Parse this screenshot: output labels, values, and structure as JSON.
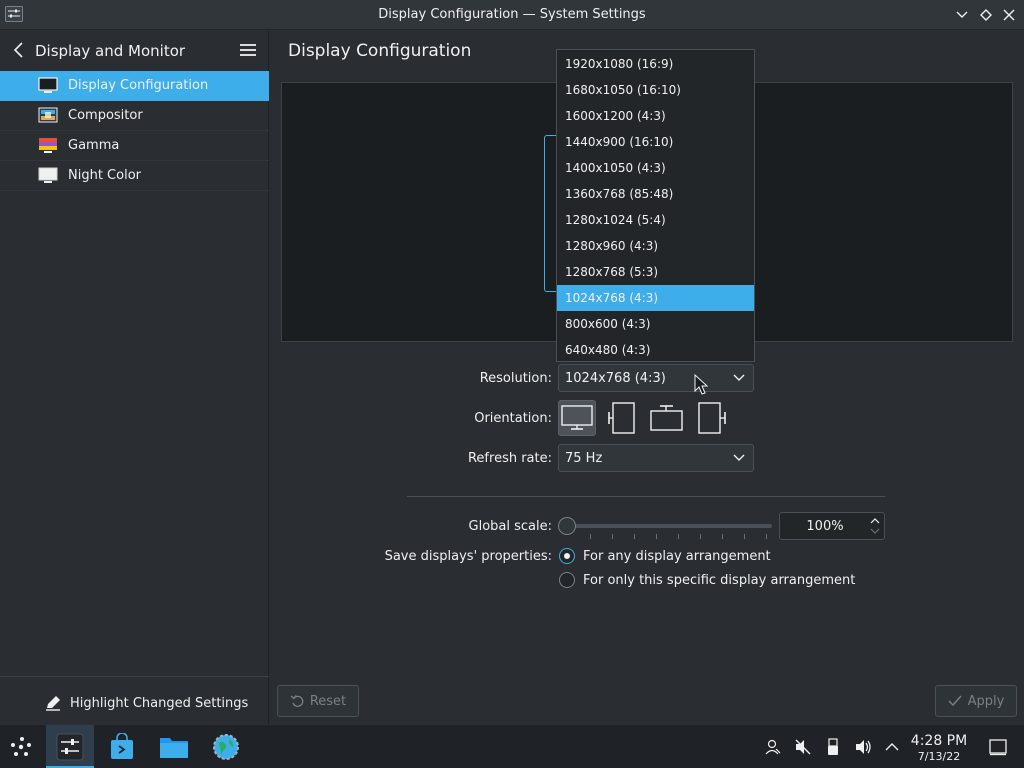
{
  "window": {
    "title": "Display Configuration — System Settings"
  },
  "sidebar": {
    "title": "Display and Monitor",
    "items": [
      {
        "label": "Display Configuration",
        "icon": "monitor-icon",
        "selected": true
      },
      {
        "label": "Compositor",
        "icon": "compositor-icon",
        "selected": false
      },
      {
        "label": "Gamma",
        "icon": "gamma-icon",
        "selected": false
      },
      {
        "label": "Night Color",
        "icon": "night-color-icon",
        "selected": false
      }
    ],
    "footer_label": "Highlight Changed Settings"
  },
  "main": {
    "title": "Display Configuration",
    "resolution_label": "Resolution:",
    "resolution_value": "1024x768 (4:3)",
    "orientation_label": "Orientation:",
    "refresh_label": "Refresh rate:",
    "refresh_value": "75 Hz",
    "scale_label": "Global scale:",
    "scale_value": "100%",
    "save_label": "Save displays' properties:",
    "radio_any": "For any display arrangement",
    "radio_specific": "For only this specific display arrangement",
    "reset_label": "Reset",
    "apply_label": "Apply"
  },
  "dropdown": {
    "options": [
      "1920x1080 (16:9)",
      "1680x1050 (16:10)",
      "1600x1200 (4:3)",
      "1440x900 (16:10)",
      "1400x1050 (4:3)",
      "1360x768 (85:48)",
      "1280x1024 (5:4)",
      "1280x960 (4:3)",
      "1280x768 (5:3)",
      "1024x768 (4:3)",
      "800x600 (4:3)",
      "640x480 (4:3)"
    ],
    "selected_index": 9
  },
  "taskbar": {
    "time": "4:28 PM",
    "date": "7/13/22"
  },
  "colors": {
    "accent": "#3daee9",
    "background": "#2a2e32",
    "panel": "#1b1e20"
  }
}
